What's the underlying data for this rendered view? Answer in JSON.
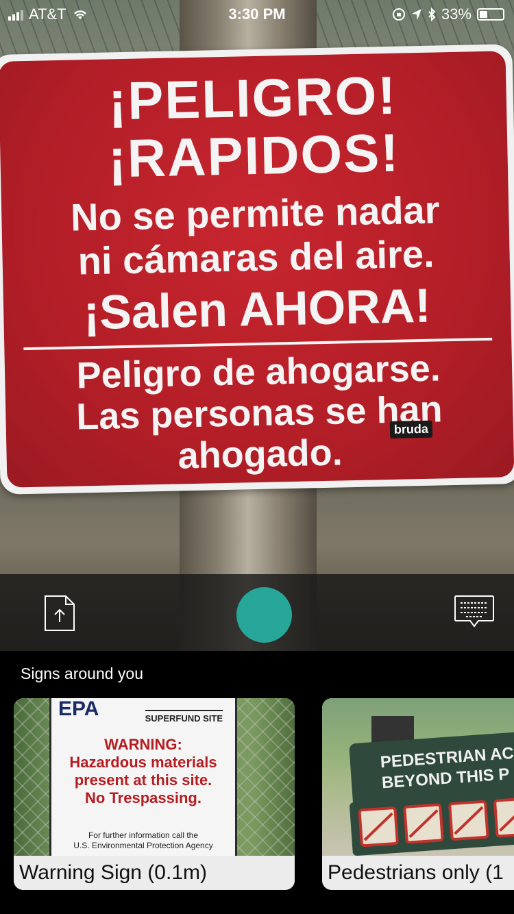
{
  "status_bar": {
    "carrier": "AT&T",
    "time": "3:30 PM",
    "battery_percent": "33%",
    "battery_level": 0.33,
    "icons": [
      "signal-icon",
      "wifi-icon",
      "screen-lock-icon",
      "location-icon",
      "bluetooth-icon",
      "battery-icon"
    ]
  },
  "camera_view": {
    "sign_lines": [
      "¡PELIGRO!",
      "¡RAPIDOS!",
      "No se permite nadar",
      "ni cámaras del aire.",
      "¡Salen AHORA!",
      "Peligro de ahogarse.",
      "Las personas se han",
      "ahogado."
    ],
    "brand_text": "bruda",
    "sign_color": "#b31e27"
  },
  "toolbar": {
    "upload_icon": "document-upload-icon",
    "shutter_color": "#26a79a",
    "chat_icon": "keyboard-chat-icon"
  },
  "signs_panel": {
    "title": "Signs around you",
    "cards": [
      {
        "caption": "Warning Sign (0.1m)",
        "image": {
          "logo": "EPA",
          "header": "SUPERFUND SITE",
          "lines": [
            "WARNING:",
            "Hazardous materials",
            "present at this site.",
            "No Trespassing."
          ],
          "footer": [
            "For further information call the",
            "U.S. Environmental Protection Agency"
          ]
        }
      },
      {
        "caption": "Pedestrians only (1",
        "image": {
          "lines": [
            "PEDESTRIAN ACCE",
            "BEYOND THIS P"
          ]
        }
      }
    ]
  }
}
